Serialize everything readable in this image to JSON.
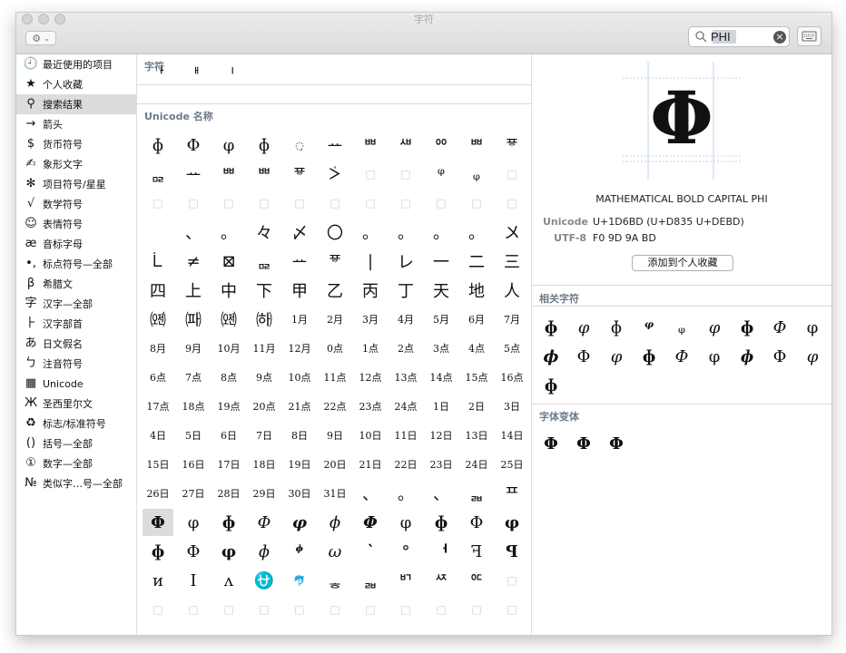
{
  "window": {
    "title": "字符"
  },
  "search": {
    "value": "PHI"
  },
  "sidebar": {
    "items": [
      {
        "icon": "clock-icon",
        "glyph": "🕘",
        "label": "最近使用的项目",
        "active": false
      },
      {
        "icon": "star-icon",
        "glyph": "★",
        "label": "个人收藏",
        "active": false
      },
      {
        "icon": "magnifier-icon",
        "glyph": "⚲",
        "label": "搜索结果",
        "active": true
      },
      {
        "icon": "arrow-icon",
        "glyph": "→",
        "label": "箭头",
        "active": false
      },
      {
        "icon": "dollar-icon",
        "glyph": "$",
        "label": "货币符号",
        "active": false
      },
      {
        "icon": "pictograph-icon",
        "glyph": "✍",
        "label": "象形文字",
        "active": false
      },
      {
        "icon": "asterisk-icon",
        "glyph": "✻",
        "label": "项目符号/星星",
        "active": false
      },
      {
        "icon": "sqrt-icon",
        "glyph": "√",
        "label": "数学符号",
        "active": false
      },
      {
        "icon": "smiley-icon",
        "glyph": "☺",
        "label": "表情符号",
        "active": false
      },
      {
        "icon": "ae-icon",
        "glyph": "æ",
        "label": "音标字母",
        "active": false
      },
      {
        "icon": "punctuation-icon",
        "glyph": "•,",
        "label": "标点符号—全部",
        "active": false
      },
      {
        "icon": "beta-icon",
        "glyph": "β",
        "label": "希腊文",
        "active": false
      },
      {
        "icon": "hanzi-icon",
        "glyph": "字",
        "label": "汉字—全部",
        "active": false
      },
      {
        "icon": "radical-icon",
        "glyph": "⺊",
        "label": "汉字部首",
        "active": false
      },
      {
        "icon": "hiragana-icon",
        "glyph": "あ",
        "label": "日文假名",
        "active": false
      },
      {
        "icon": "bopomofo-icon",
        "glyph": "ㄅ",
        "label": "注音符号",
        "active": false
      },
      {
        "icon": "unicode-grid-icon",
        "glyph": "▦",
        "label": "Unicode",
        "active": false
      },
      {
        "icon": "cyrillic-icon",
        "glyph": "Ж",
        "label": "圣西里尔文",
        "active": false
      },
      {
        "icon": "recycle-icon",
        "glyph": "♻",
        "label": "标志/标准符号",
        "active": false
      },
      {
        "icon": "parentheses-icon",
        "glyph": "()",
        "label": "括号—全部",
        "active": false
      },
      {
        "icon": "circled-one-icon",
        "glyph": "①",
        "label": "数字—全部",
        "active": false
      },
      {
        "icon": "numero-icon",
        "glyph": "№",
        "label": "类似字…号—全部",
        "active": false
      }
    ]
  },
  "center": {
    "section_chars": "字符",
    "section_unicode": "Unicode 名称",
    "char_row": [
      "ᅡ",
      "ᅢ",
      "ᅵ"
    ],
    "grid": [
      [
        "ɸ",
        "Φ",
        "φ",
        "ɸ",
        "◌̣",
        "ᅭ",
        "ᄈ",
        "ᄲ",
        "ᅇ",
        "ᄈ",
        "ᅗ"
      ],
      [
        "ᇛ",
        "ᅭ",
        "ᄈ",
        "ᄈ",
        "ᅗ",
        "ᢴ",
        "□",
        "□",
        "ᵠ",
        "ᵩ",
        "□"
      ],
      [
        "□",
        "□",
        "□",
        "□",
        "□",
        "□",
        "□",
        "□",
        "□",
        "□",
        "□"
      ],
      [
        "",
        "、",
        "。",
        "々",
        "〆",
        "〇",
        "。",
        "。",
        "。",
        "。",
        "〤"
      ],
      [
        "ᢺ",
        "≠",
        "⊠",
        "ᇛ",
        "ᅭ",
        "ᅗ",
        "|",
        "レ",
        "一",
        "二",
        "三"
      ],
      [
        "四",
        "上",
        "中",
        "下",
        "甲",
        "乙",
        "丙",
        "丁",
        "天",
        "地",
        "人"
      ],
      [
        "㈝",
        "㈚",
        "㈝",
        "㈛",
        "1月",
        "2月",
        "3月",
        "4月",
        "5月",
        "6月",
        "7月"
      ],
      [
        "8月",
        "9月",
        "10月",
        "11月",
        "12月",
        "0点",
        "1点",
        "2点",
        "3点",
        "4点",
        "5点"
      ],
      [
        "6点",
        "7点",
        "8点",
        "9点",
        "10点",
        "11点",
        "12点",
        "13点",
        "14点",
        "15点",
        "16点"
      ],
      [
        "17点",
        "18点",
        "19点",
        "20点",
        "21点",
        "22点",
        "23点",
        "24点",
        "1日",
        "2日",
        "3日"
      ],
      [
        "4日",
        "5日",
        "6日",
        "7日",
        "8日",
        "9日",
        "10日",
        "11日",
        "12日",
        "13日",
        "14日"
      ],
      [
        "15日",
        "16日",
        "17日",
        "18日",
        "19日",
        "20日",
        "21日",
        "22日",
        "23日",
        "24日",
        "25日"
      ],
      [
        "26日",
        "27日",
        "28日",
        "29日",
        "30日",
        "31日",
        "、",
        "。",
        "、",
        "ᆲ",
        "ᄑ"
      ],
      [
        "Φ",
        "φ",
        "ɸ",
        "Φ",
        "φ",
        "ϕ",
        "Φ",
        "φ",
        "ɸ",
        "Φ",
        "φ"
      ],
      [
        "ɸ",
        "Φ",
        "φ",
        "ɸ",
        "ᶲ",
        "ω",
        "`",
        "°",
        "ᅥ",
        "ꟻ",
        "ꟼ"
      ],
      [
        "ᴎ",
        "Ι",
        "ᴧ",
        "⛎",
        "🐬",
        "ᇂ",
        "ᆲ",
        "ᄞ",
        "ᄶ",
        "ᅂ",
        "□"
      ],
      [
        "□",
        "□",
        "□",
        "□",
        "□",
        "□",
        "□",
        "□",
        "□",
        "□",
        "□"
      ],
      [
        "□",
        "□",
        "□",
        "□",
        "□",
        "□",
        "□",
        "□",
        "□",
        "□",
        "□"
      ]
    ]
  },
  "detail": {
    "glyph": "Φ",
    "name": "MATHEMATICAL BOLD CAPITAL PHI",
    "unicode_label": "Unicode",
    "unicode_value": "U+1D6BD (U+D835 U+DEBD)",
    "utf8_label": "UTF-8",
    "utf8_value": "F0 9D 9A BD",
    "add_fav_label": "添加到个人收藏",
    "related_title": "相关字符",
    "related": [
      "ɸ",
      "φ",
      "ɸ",
      "ᵠ",
      "ᵩ",
      "φ",
      "ɸ",
      "Φ",
      "φ",
      "ϕ",
      "Φ",
      "φ",
      "ɸ",
      "Φ",
      "φ",
      "ɸ",
      "Φ",
      "φ",
      "ɸ"
    ],
    "variants_title": "字体变体",
    "variants": [
      "Φ",
      "Φ",
      "Φ"
    ]
  }
}
